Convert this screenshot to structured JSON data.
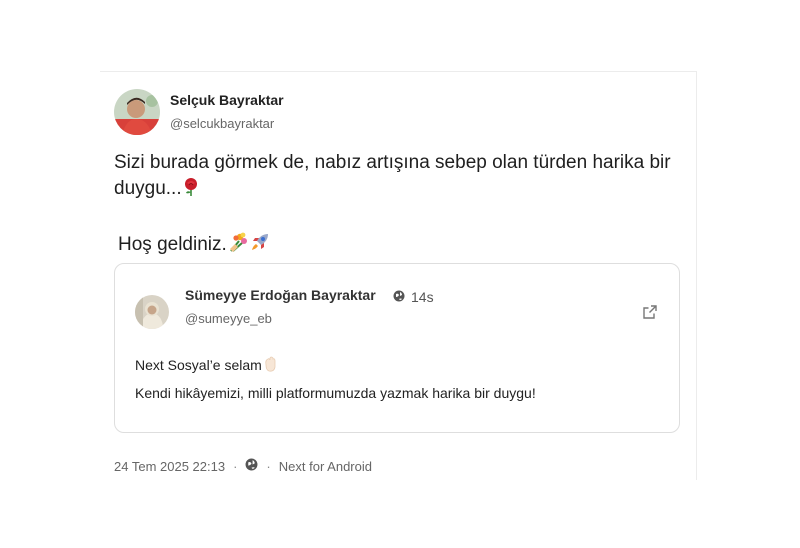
{
  "post": {
    "author_name": "Selçuk Bayraktar",
    "author_handle": "@selcukbayraktar",
    "body_line1": "Sizi burada görmek de, nabız artışına sebep olan türden harika bir",
    "body_line2": "duygu...",
    "body_line2_emoji": "rose-icon",
    "greeting": "Hoş geldiniz.",
    "greeting_emojis": [
      "bouquet-icon",
      "rocket-icon"
    ]
  },
  "quote": {
    "author_name": "Sümeyye Erdoğan Bayraktar",
    "time": "14s",
    "author_handle": "@sumeyye_eb",
    "line1": "Next Sosyal’e selam",
    "line1_emoji": "wave-hand-icon",
    "line2": "Kendi hikâyemizi, milli platformumuzda yazmak harika bir duygu!"
  },
  "footer": {
    "date": "24 Tem 2025 22:13",
    "sep1": "·",
    "sep2": "·",
    "source": "Next for Android"
  }
}
